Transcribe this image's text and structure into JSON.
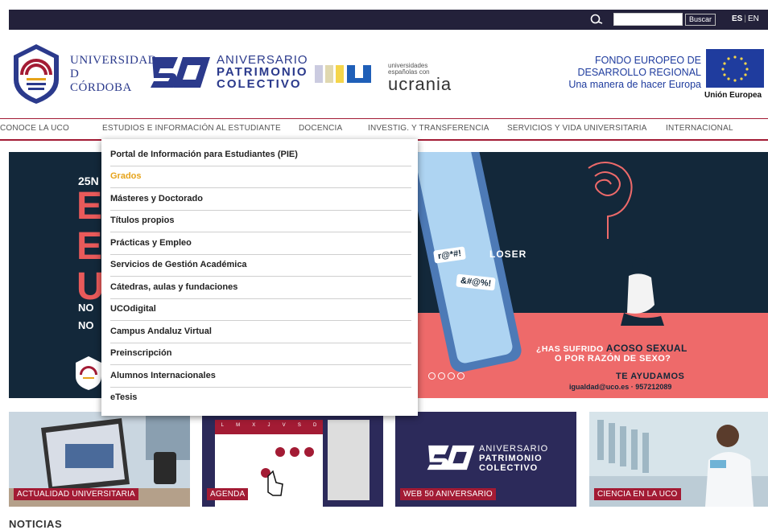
{
  "topbar": {
    "search_placeholder": "",
    "search_button": "Buscar",
    "lang_active": "ES",
    "lang_other": "EN"
  },
  "header": {
    "uco_line1": "UNIVERSIDAD",
    "uco_line2": "D",
    "uco_line3": "CÓRDOBA",
    "aniv_line1": "ANIVERSARIO",
    "aniv_line2": "PATRIMONIO",
    "aniv_line3": "COLECTIVO",
    "ucrania_small1": "universidades",
    "ucrania_small2": "españolas con",
    "ucrania_big": "ucrania",
    "feder_line1": "FONDO EUROPEO DE",
    "feder_line2": "DESARROLLO REGIONAL",
    "feder_line3": "Una manera de hacer Europa",
    "eu_label": "Unión Europea"
  },
  "nav": {
    "items": [
      "CONOCE LA UCO",
      "ESTUDIOS E INFORMACIÓN AL ESTUDIANTE",
      "DOCENCIA",
      "INVESTIG. Y TRANSFERENCIA",
      "SERVICIOS Y VIDA UNIVERSITARIA",
      "INTERNACIONAL"
    ]
  },
  "dropdown": {
    "items": [
      "Portal de Información para Estudiantes (PIE)",
      "Grados",
      "Másteres y Doctorado",
      "Títulos propios",
      "Prácticas y Empleo",
      "Servicios de Gestión Académica",
      "Cátedras, aulas y fundaciones",
      "UCOdigital",
      "Campus Andaluz Virtual",
      "Preinscripción",
      "Alumnos Internacionales",
      "eTesis"
    ],
    "active_index": 1
  },
  "banner": {
    "date_fragment": "25N",
    "letter1": "E",
    "letter2": "E",
    "letter3": "U",
    "no1": "NO",
    "no2": "NO",
    "bubble1": "r@*#!",
    "bubble2": "&#@%!",
    "loser": "LOSER",
    "line1_pre": "¿HAS SUFRIDO ",
    "line1_hl": "ACOSO SEXUAL",
    "line2": "O POR RAZÓN DE SEXO?",
    "line3": "TE AYUDAMOS",
    "line4": "igualdad@uco.es · 957212089"
  },
  "cards": [
    {
      "label": "ACTUALIDAD UNIVERSITARIA"
    },
    {
      "label": "AGENDA"
    },
    {
      "label": "WEB 50 ANIVERSARIO",
      "aniv1": "ANIVERSARIO",
      "aniv2": "PATRIMONIO",
      "aniv3": "COLECTIVO"
    },
    {
      "label": "CIENCIA EN LA UCO"
    }
  ],
  "calendar": {
    "days": [
      "L",
      "M",
      "X",
      "J",
      "V",
      "S",
      "D"
    ]
  },
  "section_title": "NOTICIAS",
  "colors": {
    "topbar": "#23213a",
    "accent": "#a31b34",
    "dropdown_active": "#e6a31a",
    "banner_bg": "#13283a",
    "banner_pink": "#ee6a6a",
    "eu_blue": "#1f3c9e"
  }
}
